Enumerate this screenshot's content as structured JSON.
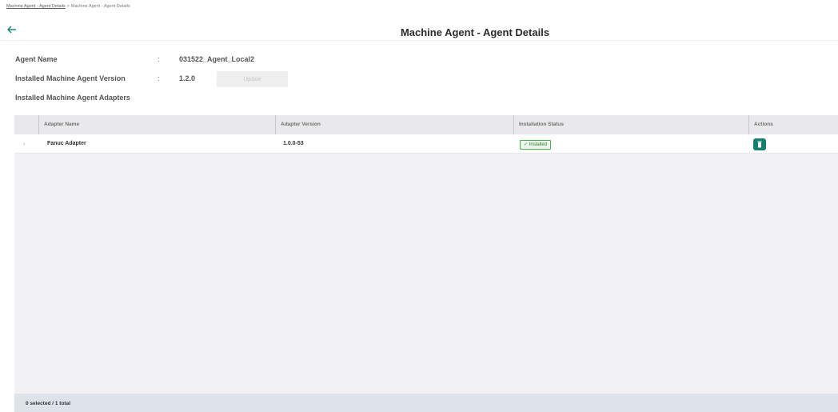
{
  "breadcrumb": {
    "items": [
      "Machine Agent - Agent Details",
      "Machine Agent - Agent Details"
    ],
    "separator": ">"
  },
  "header": {
    "title": "Machine Agent - Agent Details",
    "back_icon": "arrow-left-icon"
  },
  "info": {
    "colon": ":",
    "agent_name_label": "Agent Name",
    "agent_name_value": "031522_Agent_Local2",
    "version_label": "Installed Machine Agent Version",
    "version_value": "1.2.0",
    "update_label": "Update",
    "adapters_label": "Installed Machine Agent Adapters"
  },
  "table": {
    "columns": [
      "Adapter Name",
      "Adapter Version",
      "Installation Status",
      "Actions"
    ],
    "rows": [
      {
        "name": "Fanuc Adapter",
        "version": "1.0.0-53",
        "status": "✓ Installed",
        "action_icon": "trash-icon"
      }
    ],
    "footer": "0 selected / 1 total"
  },
  "colors": {
    "accent": "#158070",
    "status_green": "#4caf50",
    "footer_bg": "#dee3ea"
  }
}
